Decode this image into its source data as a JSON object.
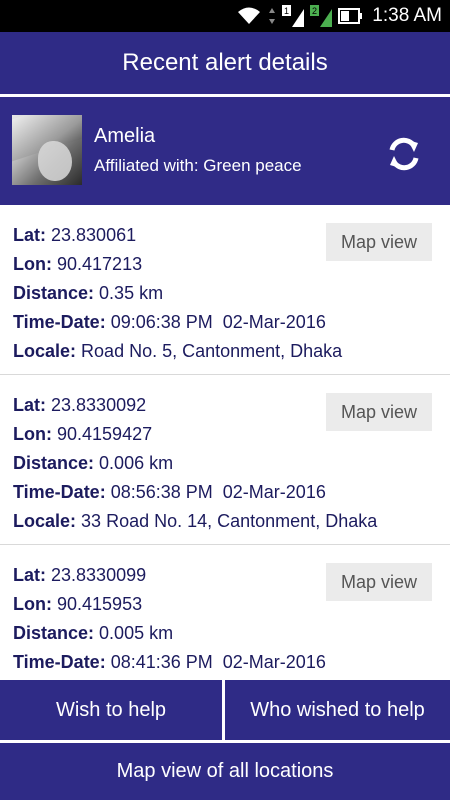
{
  "status_bar": {
    "time": "1:38 AM",
    "sim1_label": "1",
    "sim2_label": "2"
  },
  "header": {
    "title": "Recent alert details"
  },
  "profile": {
    "name": "Amelia",
    "affiliation": "Affiliated with: Green peace"
  },
  "labels": {
    "lat": "Lat:",
    "lon": "Lon:",
    "distance": "Distance:",
    "time_date": "Time-Date:",
    "locale": "Locale:"
  },
  "alerts": [
    {
      "lat": "23.830061",
      "lon": "90.417213",
      "distance": "0.35 km",
      "time_date": "09:06:38 PM  02-Mar-2016",
      "locale": "Road No. 5, Cantonment, Dhaka",
      "map_button": "Map view"
    },
    {
      "lat": "23.8330092",
      "lon": "90.4159427",
      "distance": "0.006 km",
      "time_date": "08:56:38 PM  02-Mar-2016",
      "locale": "33 Road No. 14, Cantonment, Dhaka",
      "map_button": "Map view"
    },
    {
      "lat": "23.8330099",
      "lon": "90.415953",
      "distance": "0.005 km",
      "time_date": "08:41:36 PM  02-Mar-2016",
      "locale": "",
      "map_button": "Map view"
    }
  ],
  "buttons": {
    "wish_to_help": "Wish to help",
    "who_wished": "Who wished to help",
    "map_all": "Map view of all locations"
  },
  "icons": {
    "refresh": "refresh-icon",
    "wifi": "wifi-icon",
    "signal": "signal-icon",
    "battery": "battery-icon"
  },
  "colors": {
    "primary": "#2f2b86",
    "text_dark": "#1c1b5e",
    "button_gray": "#ebebeb"
  }
}
